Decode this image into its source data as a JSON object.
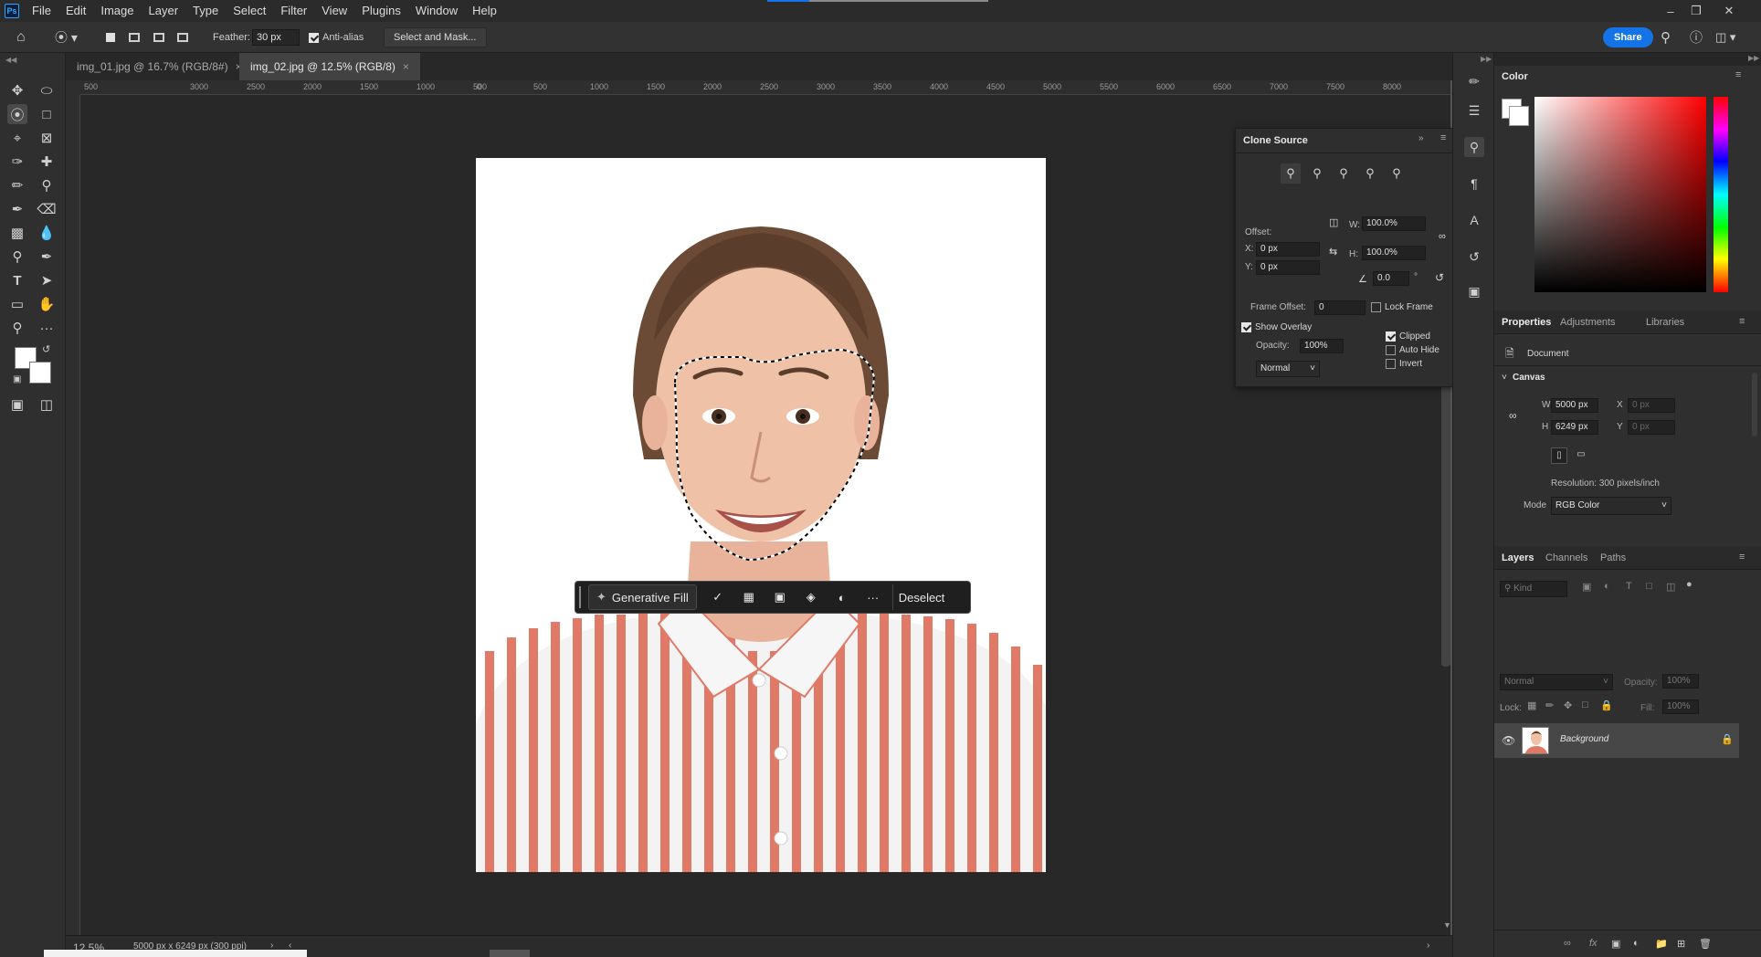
{
  "menu": {
    "items": [
      "File",
      "Edit",
      "Image",
      "Layer",
      "Type",
      "Select",
      "Filter",
      "View",
      "Plugins",
      "Window",
      "Help"
    ],
    "ps_label": "Ps"
  },
  "options": {
    "feather_label": "Feather:",
    "feather_value": "30 px",
    "anti_alias_label": "Anti-alias",
    "select_mask_label": "Select and Mask...",
    "share_label": "Share"
  },
  "tabs": [
    {
      "label": "img_01.jpg @ 16.7% (RGB/8#)"
    },
    {
      "label": "img_02.jpg @ 12.5% (RGB/8)"
    }
  ],
  "ruler": {
    "labels": [
      "500",
      "3000",
      "2500",
      "2000",
      "1500",
      "1000",
      "500",
      "0",
      "500",
      "1000",
      "1500",
      "2000",
      "2500",
      "3000",
      "3500",
      "4000",
      "4500",
      "5000",
      "5500",
      "6000",
      "6500",
      "7000",
      "7500",
      "8000"
    ]
  },
  "context_bar": {
    "generative_fill": "Generative Fill",
    "deselect": "Deselect",
    "more": "···"
  },
  "status": {
    "zoom": "12.5%",
    "doc_info": "5000 px x 6249 px (300 ppi)"
  },
  "clone_source": {
    "title": "Clone Source",
    "offset_label": "Offset:",
    "x_label": "X:",
    "x_value": "0 px",
    "y_label": "Y:",
    "y_value": "0 px",
    "w_label": "W:",
    "w_value": "100.0%",
    "h_label": "H:",
    "h_value": "100.0%",
    "angle_value": "0.0",
    "degree": "°",
    "frame_offset_label": "Frame Offset:",
    "frame_offset_value": "0",
    "lock_frame_label": "Lock Frame",
    "show_overlay_label": "Show Overlay",
    "opacity_label": "Opacity:",
    "opacity_value": "100%",
    "blend_mode": "Normal",
    "clipped_label": "Clipped",
    "auto_hide_label": "Auto Hide",
    "invert_label": "Invert"
  },
  "color_panel": {
    "title": "Color"
  },
  "properties": {
    "tabs": [
      "Properties",
      "Adjustments",
      "Libraries"
    ],
    "document_label": "Document",
    "canvas_label": "Canvas",
    "w_label": "W",
    "w_value": "5000 px",
    "h_label": "H",
    "h_value": "6249 px",
    "x_label": "X",
    "x_value": "0 px",
    "y_label": "Y",
    "y_value": "0 px",
    "resolution": "Resolution: 300 pixels/inch",
    "mode_label": "Mode",
    "mode_value": "RGB Color"
  },
  "layers": {
    "tabs": [
      "Layers",
      "Channels",
      "Paths"
    ],
    "kind_placeholder": "Kind",
    "blend_mode": "Normal",
    "opacity_label": "Opacity:",
    "opacity_value": "100%",
    "lock_label": "Lock:",
    "fill_label": "Fill:",
    "fill_value": "100%",
    "layer_name": "Background"
  },
  "colors": {
    "accent": "#1473e6",
    "selection_ant": "#000000"
  }
}
